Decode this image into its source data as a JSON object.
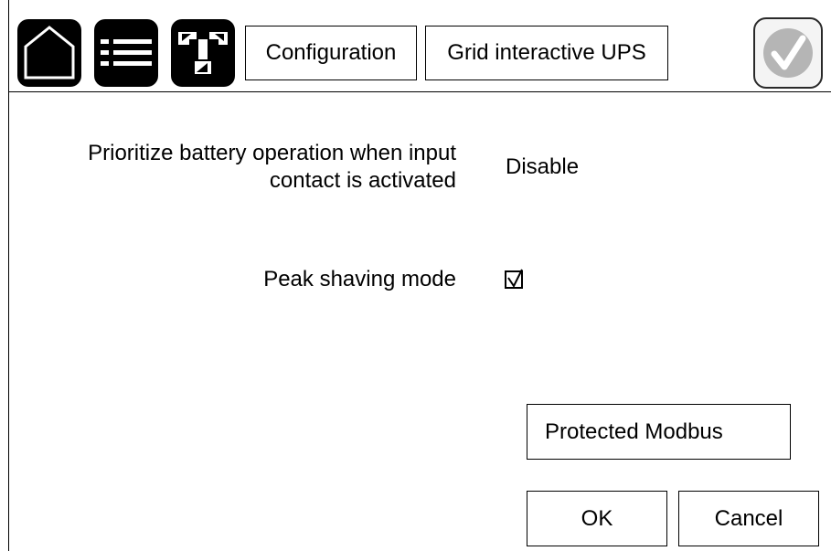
{
  "header": {
    "icons": {
      "home": "home-icon",
      "menu": "list-menu-icon",
      "tools": "tools-icon",
      "status": "checkmark-status-icon"
    },
    "breadcrumb": [
      "Configuration",
      "Grid interactive UPS"
    ]
  },
  "settings": {
    "prioritize": {
      "label_line1": "Prioritize battery operation when input",
      "label_line2": "contact is activated",
      "value": "Disable"
    },
    "peak_shaving": {
      "label": "Peak shaving mode",
      "checked": true
    }
  },
  "buttons": {
    "protected_modbus": "Protected Modbus",
    "ok": "OK",
    "cancel": "Cancel"
  },
  "colors": {
    "icon_bg": "#000000",
    "status_check": "#b5b5b5"
  }
}
